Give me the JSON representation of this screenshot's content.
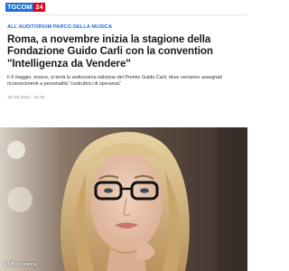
{
  "header": {
    "logo_tg": "TGCOM",
    "logo_num": "24"
  },
  "article": {
    "category": "ALL'AUDITORIUM PARCO DELLA MUSICA",
    "headline": "Roma, a novembre inizia la stagione della Fondazione Guido Carli con la convention \"Intelligenza da Vendere\"",
    "summary": "Il 9 maggio, invece, si terrà la sedicesima edizione del Premio Guido Carli, dove verranno assegnati riconoscimenti a personalità \"costruttrici di speranza\"",
    "date": "18 Ott 2024 - 16:36",
    "photo_credit": "© Ufficio stampa"
  },
  "colors": {
    "brand_blue": "#1d6fd6",
    "brand_red": "#e2001a"
  }
}
